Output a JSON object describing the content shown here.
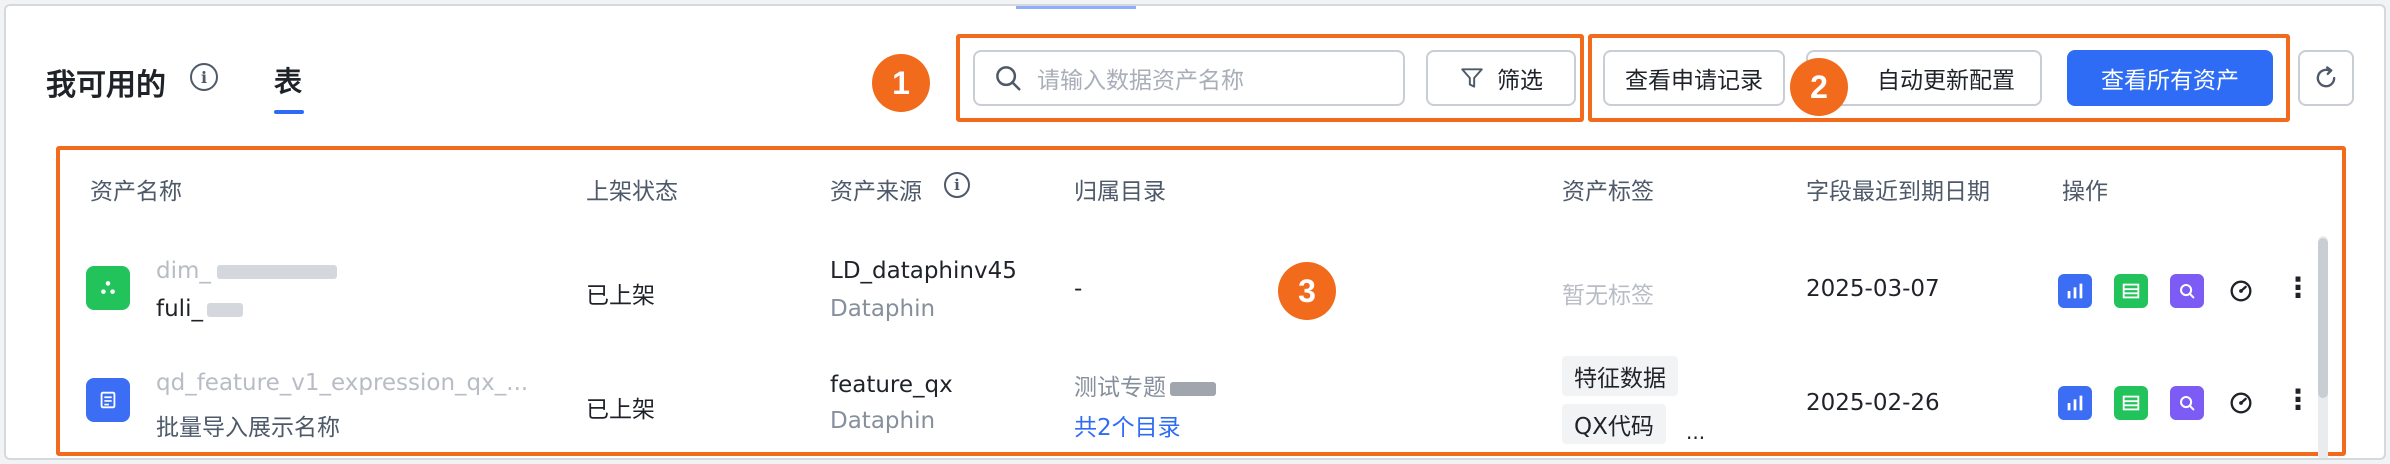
{
  "header": {
    "title": "我可用的",
    "tab_table": "表"
  },
  "search": {
    "placeholder": "请输入数据资产名称"
  },
  "toolbar": {
    "filter_label": "筛选",
    "apply_records_label": "查看申请记录",
    "auto_update_label": "自动更新配置",
    "view_all_label": "查看所有资产"
  },
  "annotations": [
    "1",
    "2",
    "3"
  ],
  "table": {
    "columns": [
      "资产名称",
      "上架状态",
      "资产来源",
      "归属目录",
      "资产标签",
      "字段最近到期日期",
      "操作"
    ],
    "rows": [
      {
        "name_primary": "dim_",
        "name_secondary": "fuli_",
        "status": "已上架",
        "source_name": "LD_dataphinv45",
        "source_type": "Dataphin",
        "catalog": "-",
        "catalog_link": "",
        "tag_empty": "暂无标签",
        "expiry": "2025-03-07"
      },
      {
        "name_primary": "qd_feature_v1_expression_qx_...",
        "name_secondary": "批量导入展示名称",
        "status": "已上架",
        "source_name": "feature_qx",
        "source_type": "Dataphin",
        "catalog": "测试专题",
        "catalog_link": "共2个目录",
        "tags": [
          "特征数据",
          "QX代码"
        ],
        "tags_more": "...",
        "expiry": "2025-02-26"
      }
    ]
  },
  "colors": {
    "accent": "#2f6cf6",
    "annotation": "#f26b1d",
    "icon_green": "#21c35a",
    "icon_blue": "#3b6ef5"
  }
}
